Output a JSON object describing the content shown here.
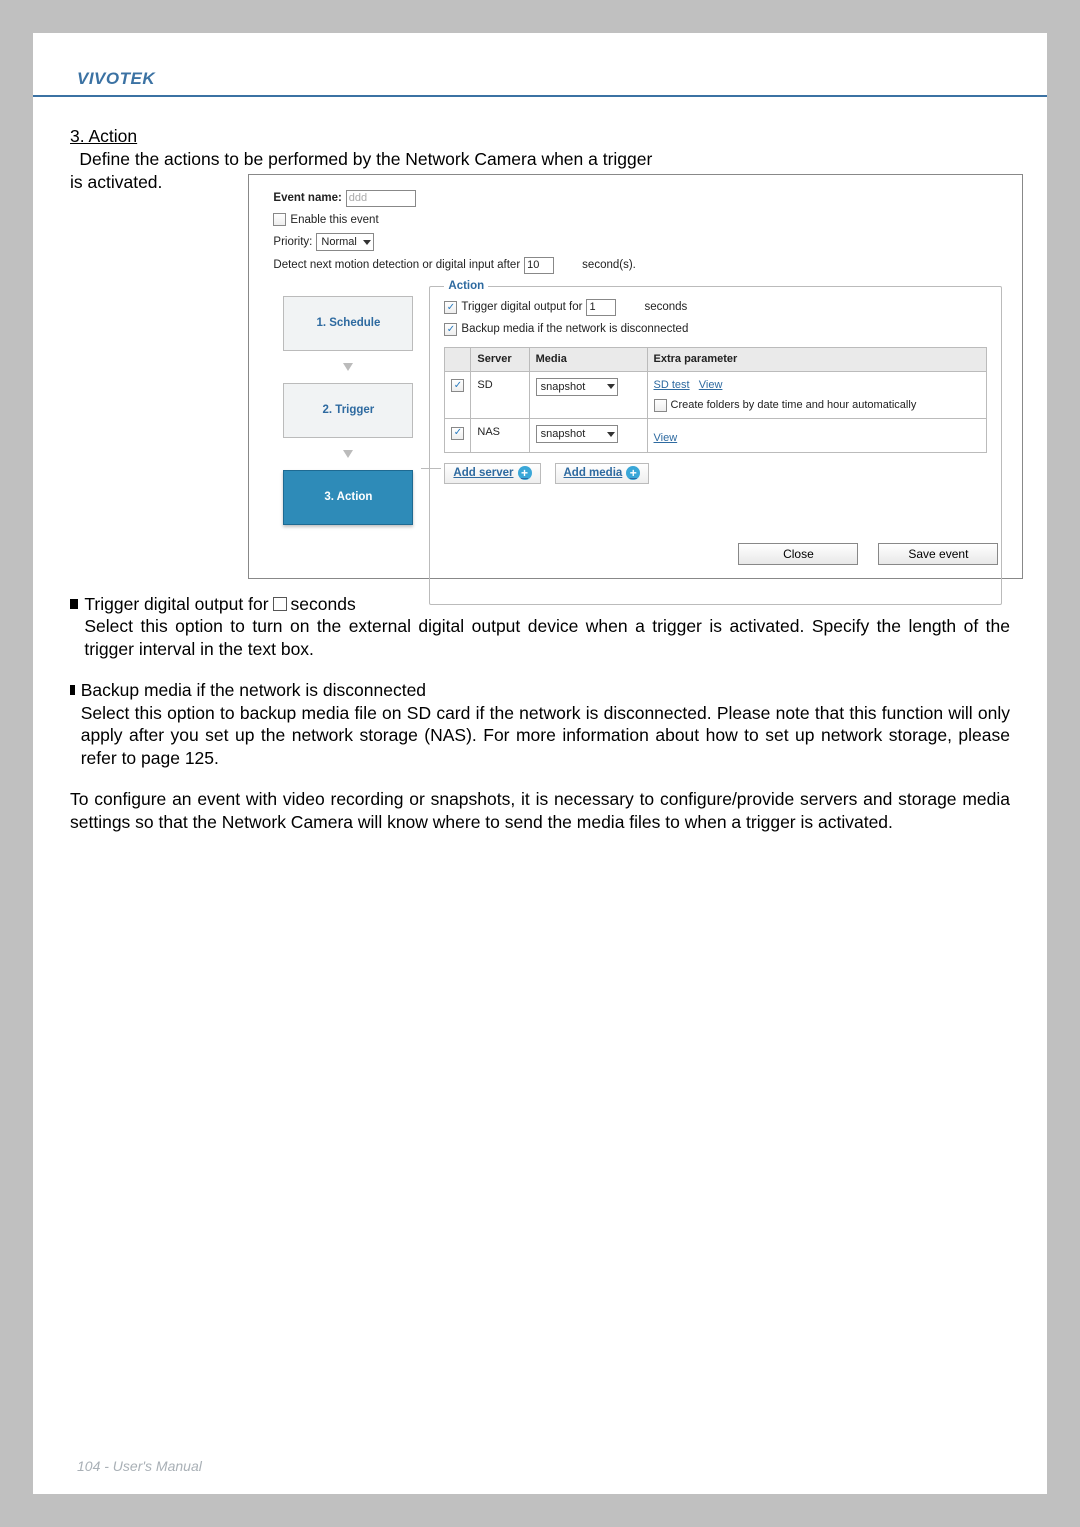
{
  "brand": "VIVOTEK",
  "section": {
    "title": "3. Action",
    "intro_line1": "Define the actions to be performed by the Network Camera when a trigger",
    "intro_line2": "is activated."
  },
  "dialog": {
    "event_name_label": "Event name:",
    "event_name_value": "ddd",
    "enable_label": "Enable this event",
    "priority_label": "Priority:",
    "priority_value": "Normal",
    "detect_label_before": "Detect next motion detection or digital input after",
    "detect_value": "10",
    "detect_label_after": "second(s).",
    "steps": {
      "s1": "1.  Schedule",
      "s2": "2.  Trigger",
      "s3": "3.  Action"
    },
    "action": {
      "legend": "Action",
      "trigger_out_before": "Trigger digital output for",
      "trigger_out_value": "1",
      "trigger_out_after": "seconds",
      "backup_label": "Backup media if the network is disconnected",
      "headers": {
        "server": "Server",
        "media": "Media",
        "extra": "Extra parameter"
      },
      "rows": [
        {
          "server": "SD",
          "media": "snapshot",
          "links": [
            "SD test",
            "View"
          ],
          "extra_checkbox_label": "Create folders by date time and hour automatically"
        },
        {
          "server": "NAS",
          "media": "snapshot",
          "links": [
            "View"
          ],
          "extra_checkbox_label": ""
        }
      ],
      "add_server": "Add server",
      "add_media": "Add media"
    },
    "buttons": {
      "close": "Close",
      "save": "Save event"
    }
  },
  "bullets": [
    {
      "title_before": "Trigger digital output for",
      "title_after": "seconds",
      "desc": "Select this option to turn on the external digital output device when a trigger is activated. Specify the length of the trigger interval in the text box."
    },
    {
      "title": "Backup media if the network is disconnected",
      "desc": "Select this option to backup media file on SD card if the network is disconnected. Please note that this function will only apply after you set up the network storage (NAS). For more information about how to set up network storage, please refer to page 125."
    }
  ],
  "closing_para": "To configure an event with video recording or snapshots, it is necessary to configure/provide servers and storage media settings so that the Network Camera will know where to send the media files to when a trigger is activated.",
  "footer": "104 - User's Manual"
}
